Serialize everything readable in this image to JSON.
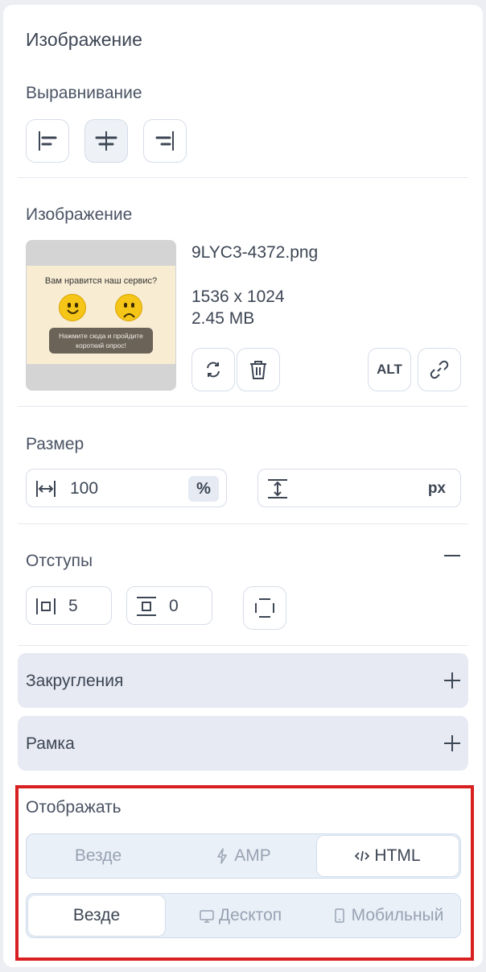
{
  "panel": {
    "title": "Изображение"
  },
  "alignment": {
    "label": "Выравнивание",
    "options": [
      "align-left",
      "align-center",
      "align-right"
    ],
    "selected": "align-center"
  },
  "image": {
    "label": "Изображение",
    "file_name": "9LYC3-4372.png",
    "dimensions": "1536 x 1024",
    "file_size": "2.45 MB",
    "preview": {
      "question": "Вам нравится наш сервис?",
      "cta_line1": "Нажмите сюда и пройдите",
      "cta_line2": "короткий опрос!"
    },
    "alt_label": "ALT"
  },
  "size": {
    "label": "Размер",
    "width_value": "100",
    "width_unit": "%",
    "height_value": "",
    "height_unit": "px"
  },
  "padding": {
    "label": "Отступы",
    "horizontal_value": "5",
    "vertical_value": "0"
  },
  "rounding": {
    "label": "Закругления"
  },
  "border": {
    "label": "Рамка"
  },
  "display": {
    "label": "Отображать",
    "format_options": [
      {
        "label": "Везде",
        "icon": ""
      },
      {
        "label": "AMP",
        "icon": "lightning-icon"
      },
      {
        "label": "HTML",
        "icon": "code-icon"
      }
    ],
    "format_selected": "HTML",
    "device_options": [
      {
        "label": "Везде",
        "icon": ""
      },
      {
        "label": "Десктоп",
        "icon": "monitor-icon"
      },
      {
        "label": "Мобильный",
        "icon": "phone-icon"
      }
    ],
    "device_selected": "Везде"
  },
  "colors": {
    "highlight": "#d92020",
    "accordion_bg": "#e7eaf3",
    "segment_bg": "#e9f0f8"
  }
}
